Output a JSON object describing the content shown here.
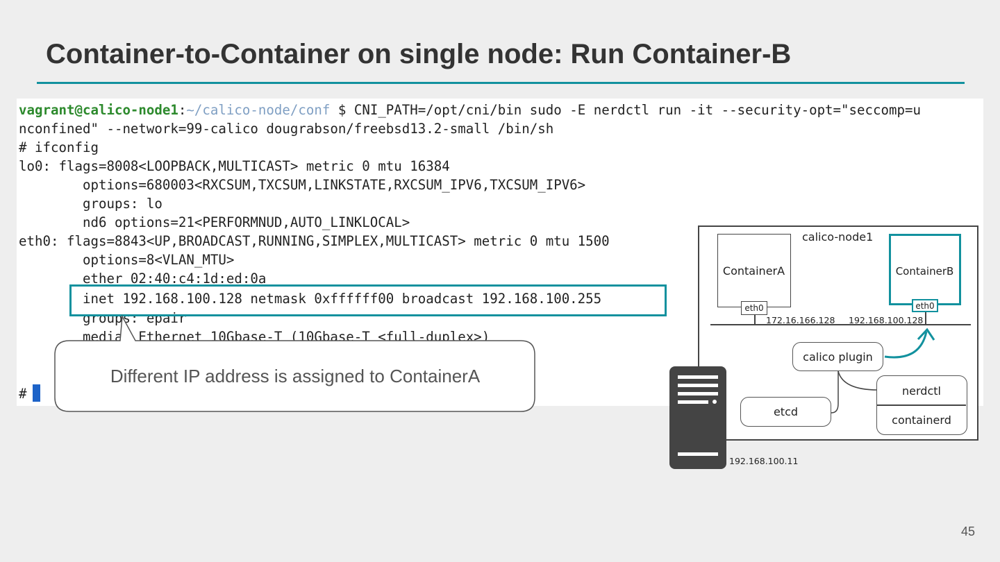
{
  "slide": {
    "title": "Container-to-Container on single node: Run Container-B",
    "page_number": "45"
  },
  "terminal": {
    "prompt_user": "vagrant@calico-node1",
    "prompt_colon": ":",
    "prompt_path": "~/calico-node/conf",
    "command_rest": " $ CNI_PATH=/opt/cni/bin sudo -E nerdctl run -it --security-opt=\"seccomp=u",
    "lines": [
      "nconfined\" --network=99-calico dougrabson/freebsd13.2-small /bin/sh",
      "# ifconfig",
      "lo0: flags=8008<LOOPBACK,MULTICAST> metric 0 mtu 16384",
      "        options=680003<RXCSUM,TXCSUM,LINKSTATE,RXCSUM_IPV6,TXCSUM_IPV6>",
      "        groups: lo",
      "        nd6 options=21<PERFORMNUD,AUTO_LINKLOCAL>",
      "eth0: flags=8843<UP,BROADCAST,RUNNING,SIMPLEX,MULTICAST> metric 0 mtu 1500",
      "        options=8<VLAN_MTU>",
      "        ether 02:40:c4:1d:ed:0a",
      "        inet 192.168.100.128 netmask 0xffffff00 broadcast 192.168.100.255",
      "        groups: epair",
      "        media: Ethernet 10Gbase-T (10Gbase-T <full-duplex>)"
    ],
    "final_prompt": "#"
  },
  "callout": {
    "text": "Different IP address is assigned to ContainerA"
  },
  "diagram": {
    "node_label": "calico-node1",
    "container_a": "ContainerA",
    "container_b": "ContainerB",
    "eth_a": "eth0",
    "eth_b": "eth0",
    "ip_a": "172.16.166.128",
    "ip_b": "192.168.100.128",
    "calico_plugin": "calico plugin",
    "nerdctl": "nerdctl",
    "containerd": "containerd",
    "etcd": "etcd",
    "host_ip": "192.168.100.11"
  },
  "colors": {
    "accent": "#12919e",
    "prompt_user": "#2d8a2d",
    "prompt_path": "#7f9fc3",
    "cursor": "#1d63c8"
  }
}
